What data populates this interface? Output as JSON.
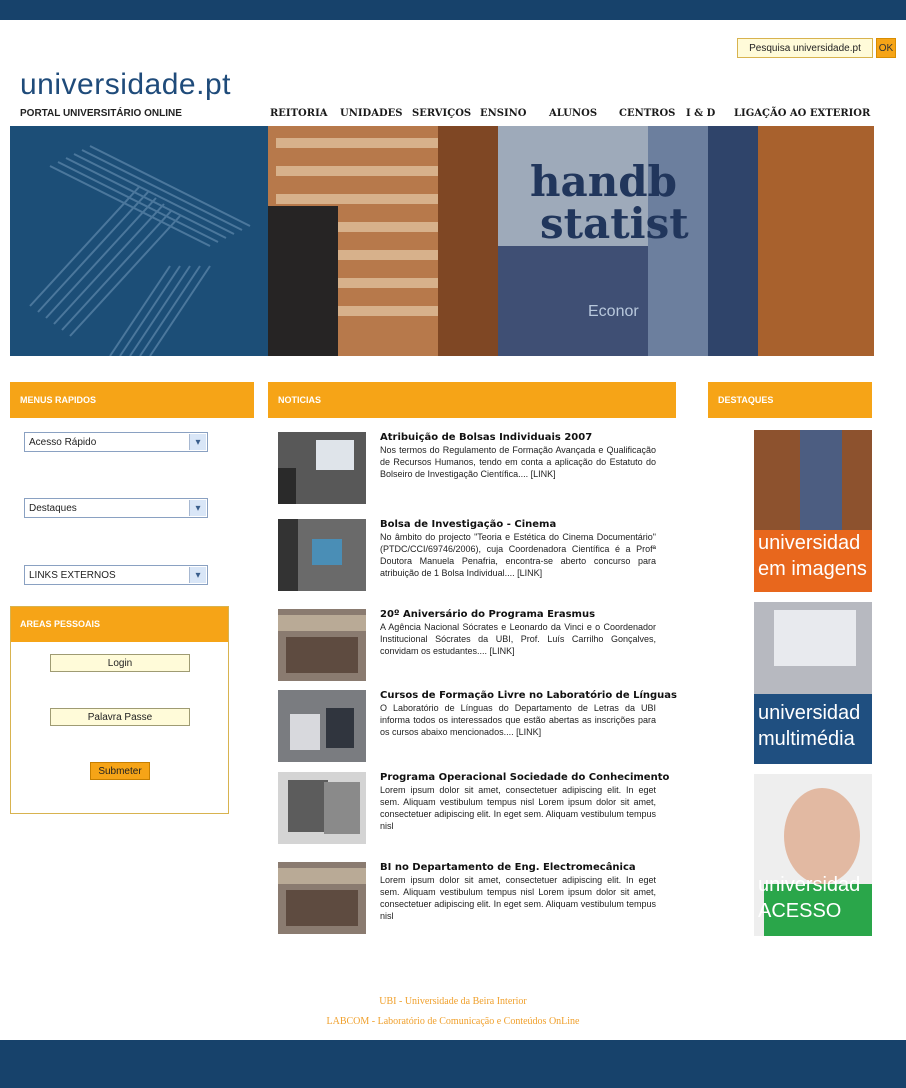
{
  "site": {
    "brand": "universidade.pt",
    "tagline": "PORTAL UNIVERSITÁRIO ONLINE"
  },
  "search": {
    "placeholder": "Pesquisa universidade.pt",
    "ok_label": "OK"
  },
  "nav": {
    "items": [
      "REITORIA",
      "UNIDADES",
      "SERVIÇOS",
      "ENSINO",
      "ALUNOS",
      "CENTROS",
      "I & D",
      "LIGAÇÃO AO EXTERIOR"
    ]
  },
  "hero": {
    "book_text_1": "handb",
    "book_text_2": "statist",
    "book_text_3": "Econor"
  },
  "sidebar": {
    "menus_title": "MENUS RAPIDOS",
    "select_acesso": "Acesso Rápido",
    "select_destaques": "Destaques",
    "select_links": "LINKS EXTERNOS",
    "areas_title": "AREAS PESSOAIS",
    "login_placeholder": "Login",
    "password_placeholder": "Palavra Passe",
    "submit_label": "Submeter"
  },
  "news": {
    "title": "NOTICIAS",
    "items": [
      {
        "title": "Atribuição de Bolsas Individuais 2007",
        "body": "Nos termos do Regulamento de Formação Avançada e Qualificação de Recursos Humanos, tendo em conta a aplicação do Estatuto do Bolseiro de Investigação Científica.... [LINK]"
      },
      {
        "title": "Bolsa de Investigação - Cinema",
        "body": "No âmbito do projecto \"Teoria e Estética do Cinema Documentário\" (PTDC/CCI/69746/2006), cuja Coordenadora Científica é a Profª Doutora Manuela Penafria, encontra-se aberto concurso para atribuição de 1 Bolsa Individual.... [LINK]"
      },
      {
        "title": "20º Aniversário do Programa Erasmus",
        "body": "A Agência Nacional Sócrates e Leonardo da Vinci e o Coordenador Institucional Sócrates da UBI, Prof. Luís Carrilho Gonçalves, convidam os estudantes.... [LINK]"
      },
      {
        "title": "Cursos de Formação Livre no Laboratório de Línguas",
        "body": "O Laboratório de Línguas do Departamento de Letras da UBI informa todos os interessados que estão abertas as inscrições para os cursos abaixo mencionados.... [LINK]"
      },
      {
        "title": "Programa Operacional Sociedade do Conhecimento",
        "body": "Lorem ipsum dolor sit amet, consectetuer adipiscing elit. In eget sem. Aliquam vestibulum tempus nisl Lorem ipsum dolor sit amet, consectetuer adipiscing elit. In eget sem. Aliquam vestibulum tempus nisl"
      },
      {
        "title": "BI no Departamento de Eng. Electromecânica",
        "body": "Lorem ipsum dolor sit amet, consectetuer adipiscing elit. In eget sem. Aliquam vestibulum tempus nisl Lorem ipsum dolor sit amet, consectetuer adipiscing elit. In eget sem. Aliquam vestibulum tempus nisl"
      }
    ]
  },
  "destaques": {
    "title": "DESTAQUES",
    "items": [
      {
        "line1": "universidad",
        "line2": "em imagens",
        "color": "#e8671d"
      },
      {
        "line1": "universidad",
        "line2": "multimédia",
        "color": "#1f4f80"
      },
      {
        "line1": "universidad",
        "line2": "ACESSO",
        "color": "#2aa64a"
      }
    ]
  },
  "footer": {
    "line1": "UBI - Universidade da Beira Interior",
    "line2": "LABCOM - Laboratório de Comunicação e Conteúdos OnLine"
  },
  "colors": {
    "navy": "#17426b",
    "orange": "#f6a417",
    "brand": "#1f4b7a"
  }
}
